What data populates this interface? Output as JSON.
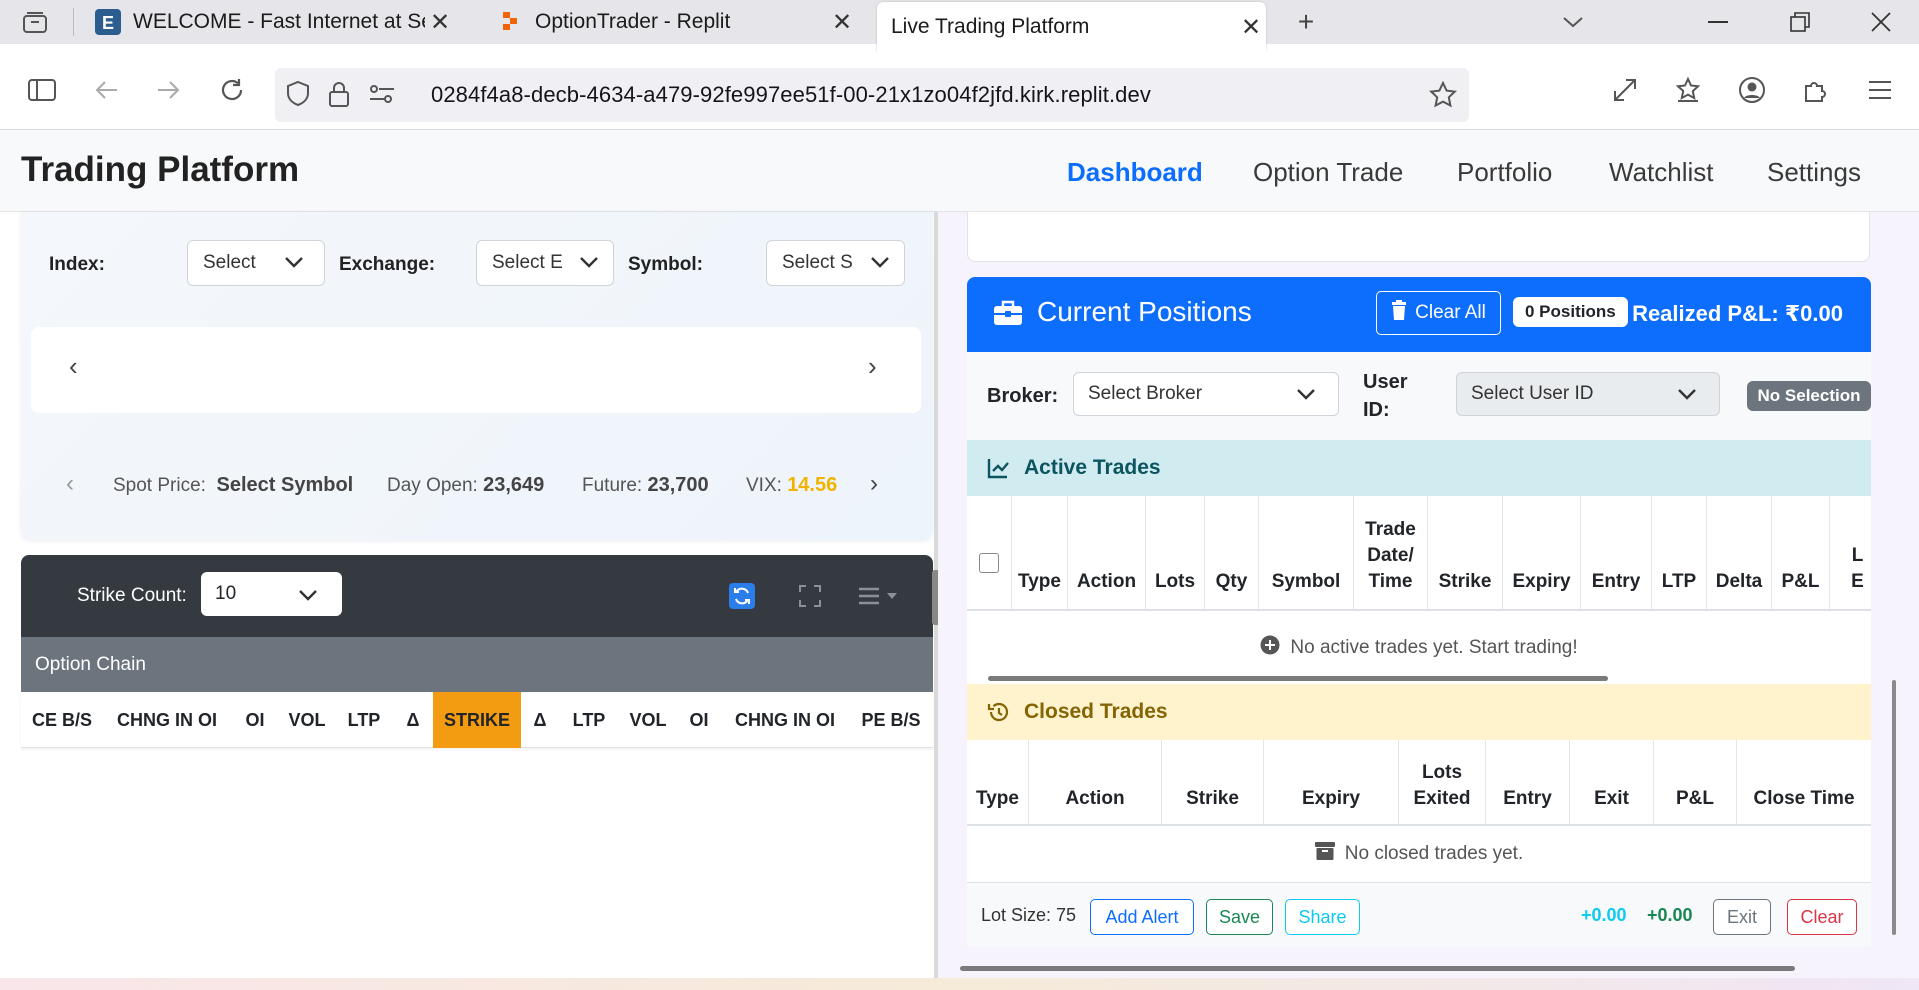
{
  "browser": {
    "tabs": [
      {
        "title": "WELCOME - Fast Internet at Sea"
      },
      {
        "title": "OptionTrader - Replit"
      },
      {
        "title": "Live Trading Platform"
      }
    ],
    "url": "0284f4a8-decb-4634-a479-92fe997ee51f-00-21x1zo04f2jfd.kirk.replit.dev"
  },
  "app": {
    "brand": "Trading Platform",
    "menu": [
      "Dashboard",
      "Option Trade",
      "Portfolio",
      "Watchlist",
      "Settings"
    ],
    "active_menu": "Dashboard"
  },
  "filters": {
    "index_label": "Index:",
    "index_value": "Select",
    "exchange_label": "Exchange:",
    "exchange_value": "Select E",
    "symbol_label": "Symbol:",
    "symbol_value": "Select S"
  },
  "market": {
    "spot_label": "Spot Price:",
    "spot_value": "Select Symbol",
    "day_open_label": "Day Open:",
    "day_open_value": "23,649",
    "future_label": "Future:",
    "future_value": "23,700",
    "vix_label": "VIX:",
    "vix_value": "14.56",
    "vix_color": "#f0b400"
  },
  "chain": {
    "strike_count_label": "Strike Count:",
    "strike_count_value": "10",
    "title": "Option Chain",
    "columns": [
      "CE B/S",
      "CHNG IN OI",
      "OI",
      "VOL",
      "LTP",
      "Δ",
      "STRIKE",
      "Δ",
      "LTP",
      "VOL",
      "OI",
      "CHNG IN OI",
      "PE B/S"
    ],
    "strike_color": "#f39c12"
  },
  "positions": {
    "title": "Current Positions",
    "clear_all": "Clear All",
    "count_badge": "0 Positions",
    "realized": "Realized P&L: ₹0.00",
    "header_color": "#0d6efd",
    "broker_label": "Broker:",
    "broker_value": "Select Broker",
    "user_label_1": "User",
    "user_label_2": "ID:",
    "user_value": "Select User ID",
    "selection_badge": "No Selection"
  },
  "active_trades": {
    "title": "Active Trades",
    "columns": [
      "Type",
      "Action",
      "Lots",
      "Qty",
      "Symbol",
      "Trade Date/ Time",
      "Strike",
      "Expiry",
      "Entry",
      "LTP",
      "Delta",
      "P&L",
      "L E"
    ],
    "empty": "No active trades yet. Start trading!"
  },
  "closed_trades": {
    "title": "Closed Trades",
    "columns": [
      "Type",
      "Action",
      "Strike",
      "Expiry",
      "Lots Exited",
      "Entry",
      "Exit",
      "P&L",
      "Close Time"
    ],
    "empty": "No closed trades yet."
  },
  "footer": {
    "lot_size": "Lot Size: 75",
    "add_alert": "Add Alert",
    "save": "Save",
    "share": "Share",
    "pl_1": "+0.00",
    "pl_2": "+0.00",
    "exit": "Exit",
    "clear": "Clear"
  }
}
